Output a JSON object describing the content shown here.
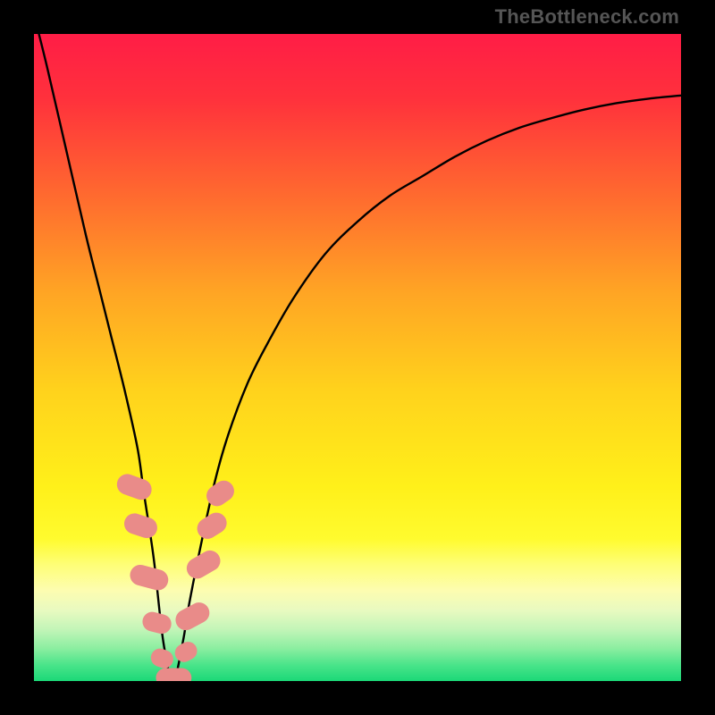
{
  "watermark": "TheBottleneck.com",
  "gradient": {
    "stops": [
      {
        "offset": 0.0,
        "color": "#ff1d46"
      },
      {
        "offset": 0.1,
        "color": "#ff313c"
      },
      {
        "offset": 0.25,
        "color": "#ff6a2f"
      },
      {
        "offset": 0.4,
        "color": "#ffa524"
      },
      {
        "offset": 0.55,
        "color": "#ffd21c"
      },
      {
        "offset": 0.7,
        "color": "#fff01a"
      },
      {
        "offset": 0.78,
        "color": "#fffb2e"
      },
      {
        "offset": 0.82,
        "color": "#fefe77"
      },
      {
        "offset": 0.86,
        "color": "#fdfdb0"
      },
      {
        "offset": 0.89,
        "color": "#e9fac0"
      },
      {
        "offset": 0.92,
        "color": "#c3f5b8"
      },
      {
        "offset": 0.95,
        "color": "#8aeea0"
      },
      {
        "offset": 0.975,
        "color": "#4ae48a"
      },
      {
        "offset": 1.0,
        "color": "#1bd877"
      }
    ]
  },
  "colors": {
    "curve": "#000000",
    "marker_fill": "#e98b89",
    "marker_stroke": "#d97270"
  },
  "chart_data": {
    "type": "line",
    "title": "",
    "xlabel": "",
    "ylabel": "",
    "xlim": [
      0,
      100
    ],
    "ylim": [
      0,
      100
    ],
    "series": [
      {
        "name": "bottleneck-curve",
        "x": [
          0,
          2,
          5,
          8,
          10,
          12,
          14,
          16,
          17,
          18.5,
          20,
          21.5,
          23,
          24,
          26,
          28,
          30,
          33,
          36,
          40,
          45,
          50,
          55,
          60,
          65,
          70,
          75,
          80,
          85,
          90,
          95,
          100
        ],
        "y": [
          103,
          95,
          82,
          69,
          61,
          53,
          45,
          36,
          29,
          19,
          6,
          0,
          6,
          12,
          22,
          31,
          38,
          46,
          52,
          59,
          66,
          71,
          75,
          78,
          81,
          83.5,
          85.5,
          87,
          88.3,
          89.3,
          90,
          90.5
        ]
      }
    ],
    "markers": [
      {
        "x": 15.5,
        "y": 30,
        "w": 3.2,
        "h": 5.5,
        "rot": -70
      },
      {
        "x": 16.5,
        "y": 24,
        "w": 3.2,
        "h": 5.2,
        "rot": -72
      },
      {
        "x": 17.8,
        "y": 16,
        "w": 3.2,
        "h": 6.0,
        "rot": -75
      },
      {
        "x": 19.0,
        "y": 9,
        "w": 3.0,
        "h": 4.5,
        "rot": -76
      },
      {
        "x": 19.8,
        "y": 3.5,
        "w": 2.8,
        "h": 3.5,
        "rot": -70
      },
      {
        "x": 21.6,
        "y": 0.5,
        "w": 5.5,
        "h": 3.0,
        "rot": 0
      },
      {
        "x": 23.5,
        "y": 4.5,
        "w": 2.8,
        "h": 3.5,
        "rot": 62
      },
      {
        "x": 24.5,
        "y": 10,
        "w": 3.2,
        "h": 5.5,
        "rot": 62
      },
      {
        "x": 26.2,
        "y": 18,
        "w": 3.2,
        "h": 5.5,
        "rot": 60
      },
      {
        "x": 27.5,
        "y": 24,
        "w": 3.2,
        "h": 4.8,
        "rot": 58
      },
      {
        "x": 28.8,
        "y": 29,
        "w": 3.2,
        "h": 4.5,
        "rot": 55
      }
    ],
    "minimum": {
      "x": 21.5,
      "y": 0
    }
  }
}
